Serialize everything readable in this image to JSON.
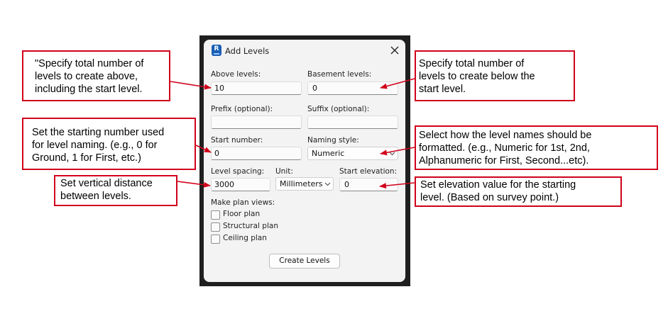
{
  "dialog": {
    "title": "Add Levels",
    "app_icon_letter": "R",
    "above_levels": {
      "label": "Above levels:",
      "value": "10"
    },
    "basement_levels": {
      "label": "Basement levels:",
      "value": "0"
    },
    "prefix": {
      "label": "Prefix (optional):",
      "value": ""
    },
    "suffix": {
      "label": "Suffix (optional):",
      "value": ""
    },
    "start_number": {
      "label": "Start number:",
      "value": "0"
    },
    "naming_style": {
      "label": "Naming style:",
      "value": "Numeric"
    },
    "level_spacing": {
      "label": "Level spacing:",
      "value": "3000"
    },
    "unit": {
      "label": "Unit:",
      "value": "Millimeters"
    },
    "start_elevation": {
      "label": "Start elevation:",
      "value": "0"
    },
    "plan_views": {
      "label": "Make plan views:",
      "items": [
        {
          "label": "Floor plan",
          "checked": false
        },
        {
          "label": "Structural plan",
          "checked": false
        },
        {
          "label": "Ceiling plan",
          "checked": false
        }
      ]
    },
    "create_button": "Create Levels"
  },
  "callouts": {
    "above": [
      "\"Specify total number of",
      "levels to create above,",
      "including the start level."
    ],
    "below": [
      "Specify total number of",
      "levels to create below the",
      "start level."
    ],
    "start_number": [
      "Set the starting number used",
      "for level naming. (e.g., 0 for",
      "Ground, 1 for First, etc.)"
    ],
    "naming_style": [
      "Select how the level names should be",
      "formatted. (e.g., Numeric for 1st, 2nd,",
      "Alphanumeric for First, Second...etc)."
    ],
    "spacing": [
      "Set vertical distance",
      "between levels."
    ],
    "elevation": [
      "Set elevation value for the starting",
      "level. (Based on survey point.)"
    ]
  },
  "colors": {
    "callout_border": "#d0021b",
    "arrow": "#d0021b",
    "dialog_bg": "#f3f3f3",
    "frame": "#1f1f1f"
  }
}
